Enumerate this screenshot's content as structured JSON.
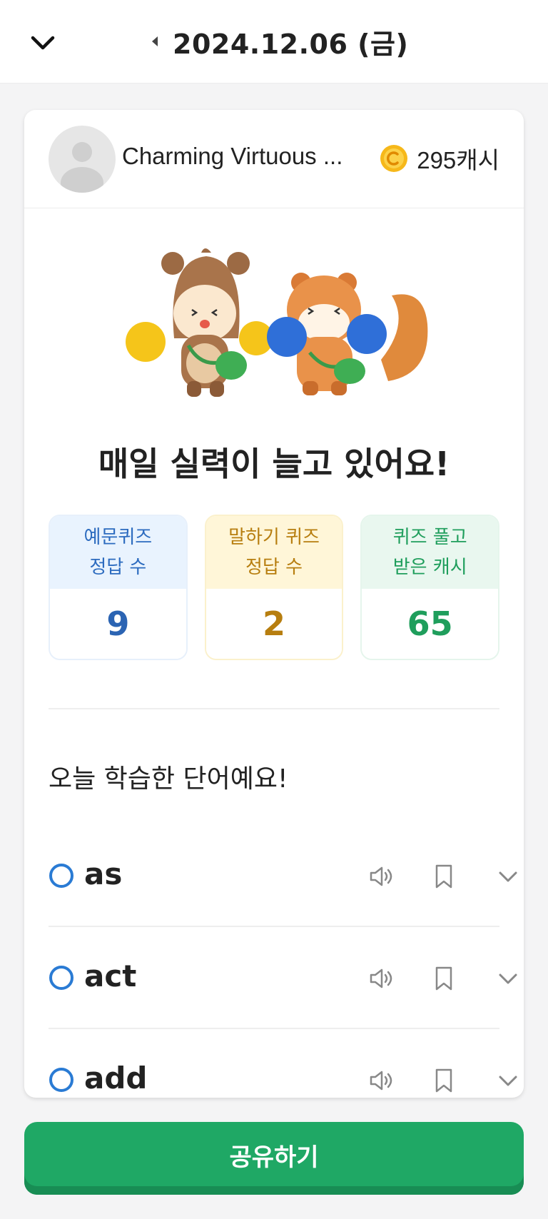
{
  "header": {
    "date": "2024.12.06 (금)",
    "back_icon": "chevron-down-icon",
    "prev_icon": "caret-left-icon"
  },
  "profile": {
    "name": "Charming Virtuous ...",
    "cash": "295캐시",
    "coin_icon": "coin-icon"
  },
  "headline": "매일 실력이 늘고 있어요!",
  "stats": [
    {
      "line1": "예문퀴즈",
      "line2": "정답 수",
      "value": "9",
      "color": "#2b64b3"
    },
    {
      "line1": "말하기 퀴즈",
      "line2": "정답 수",
      "value": "2",
      "color": "#b77e0f"
    },
    {
      "line1": "퀴즈 풀고",
      "line2": "받은 캐시",
      "value": "65",
      "color": "#1f9e5c"
    }
  ],
  "section_title": "오늘 학습한 단어예요!",
  "words": [
    {
      "word": "as"
    },
    {
      "word": "act"
    },
    {
      "word": "add"
    }
  ],
  "share_label": "공유하기",
  "colors": {
    "accent_green": "#1fa865",
    "ring_blue": "#2a7bd4"
  }
}
